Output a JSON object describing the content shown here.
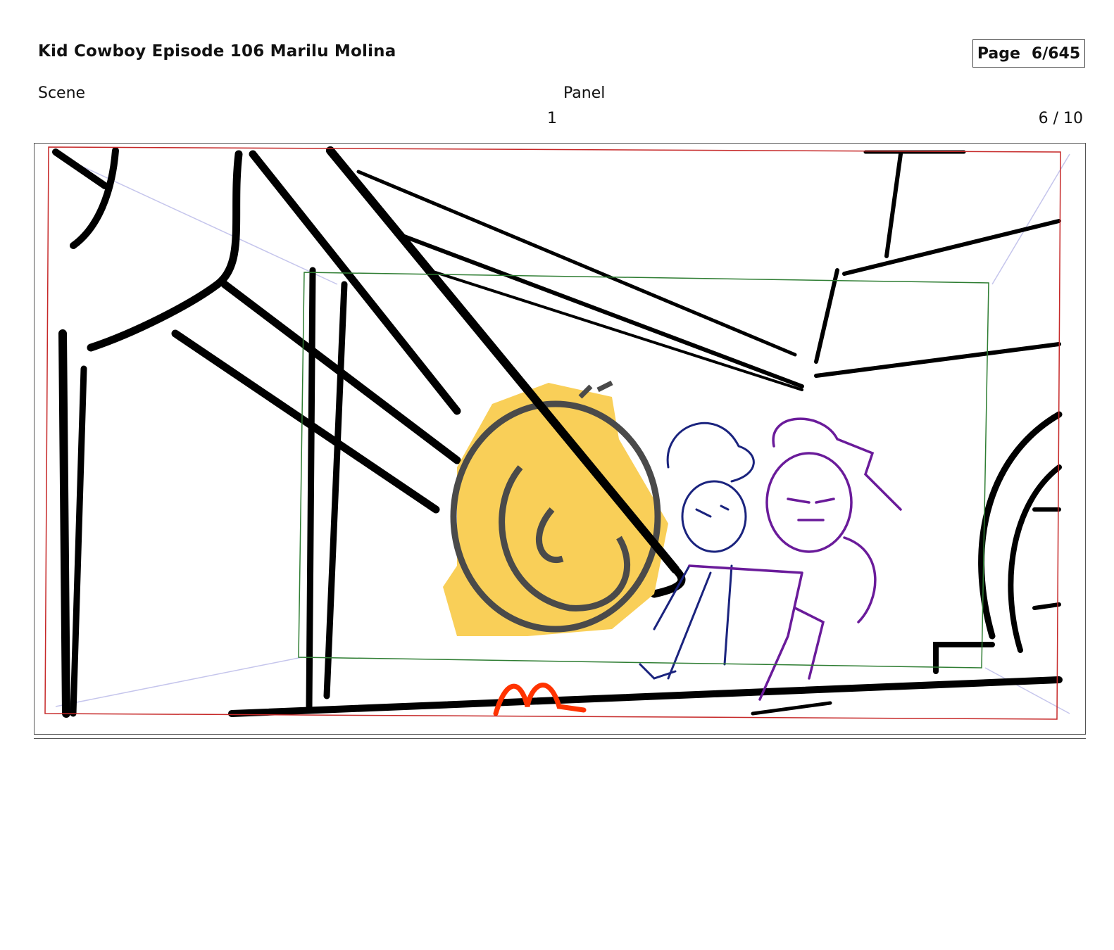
{
  "header": {
    "title": "Kid Cowboy Episode 106 Marilu Molina",
    "page_label": "Page",
    "page_value": "6/645"
  },
  "meta": {
    "scene_label": "Scene",
    "panel_label": "Panel",
    "scene_value": "1",
    "panel_value": "6 / 10"
  },
  "panel_art": {
    "description_colors": {
      "ink": "#000000",
      "safe_frame": "#2e7d32",
      "camera_frame": "#c62828",
      "perspective_guides": "#b3b3e6",
      "gear": "#f9cf58",
      "gear_outline": "#4a4a4a",
      "character_left": "#1a237e",
      "character_right": "#6a1b9a",
      "accent_red": "#ff3300"
    }
  }
}
